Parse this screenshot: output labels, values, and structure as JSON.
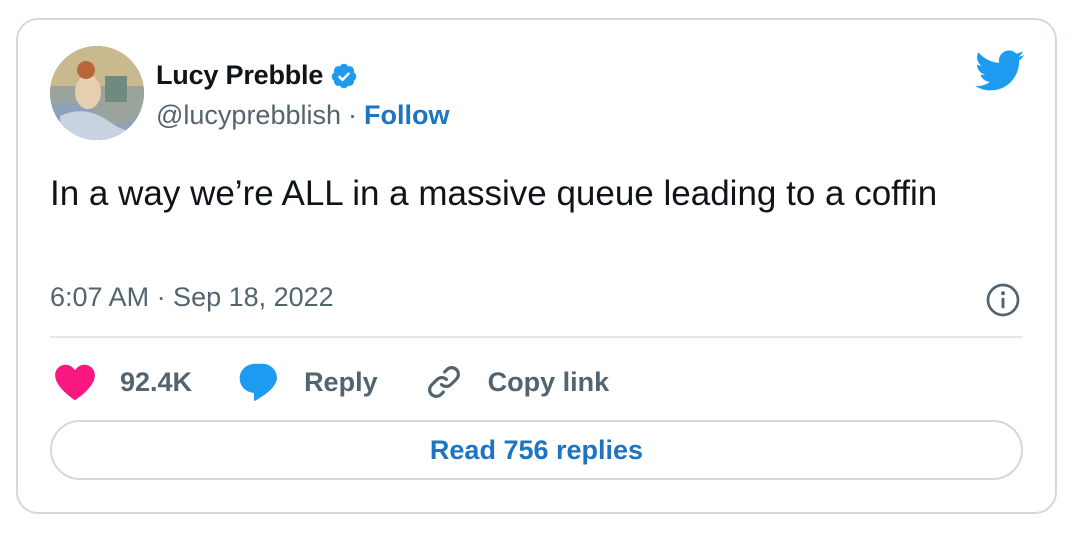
{
  "author": {
    "name": "Lucy Prebble",
    "handle": "@lucyprebblish",
    "separator": "·",
    "follow_label": "Follow",
    "verified": true,
    "avatar_icon": "painting-portrait-avatar"
  },
  "tweet": {
    "text": "In a way we’re ALL in a massive queue leading to a coffin",
    "timestamp": "6:07 AM · Sep 18, 2022"
  },
  "actions": {
    "like_count": "92.4K",
    "reply_label": "Reply",
    "copy_link_label": "Copy link"
  },
  "footer": {
    "read_replies_label": "Read 756 replies"
  },
  "icons": {
    "brand": "twitter-bird-icon",
    "verified": "verified-badge-icon",
    "info": "info-icon",
    "like": "heart-icon",
    "reply": "speech-bubble-icon",
    "copy_link": "link-icon"
  },
  "colors": {
    "twitter_blue": "#1d9bf0",
    "link_blue": "#1d74c2",
    "like_pink": "#f91880",
    "text_primary": "#0f1419",
    "text_secondary": "#536471",
    "border": "#cfd9de"
  }
}
